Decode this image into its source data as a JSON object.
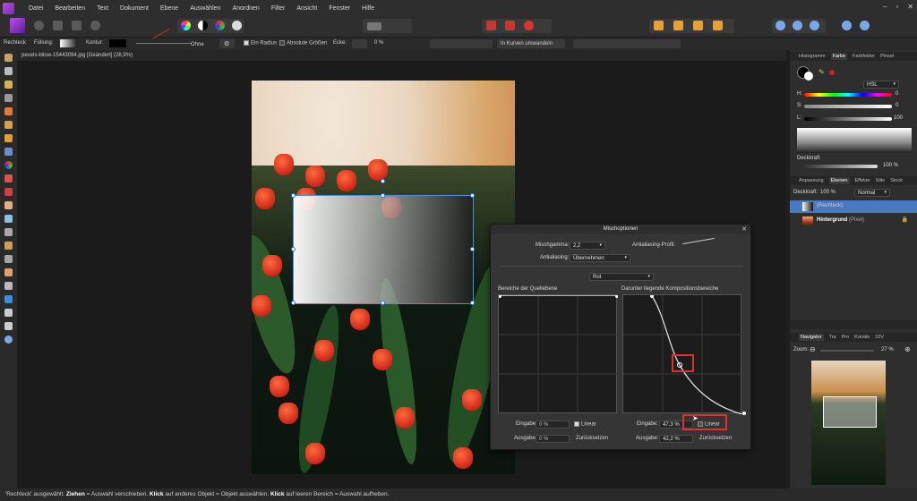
{
  "menu": {
    "items": [
      "Datei",
      "Bearbeiten",
      "Text",
      "Dokument",
      "Ebene",
      "Auswählen",
      "Anordnen",
      "Filter",
      "Ansicht",
      "Fenster",
      "Hilfe"
    ]
  },
  "context_bar": {
    "tool_name": "Rechteck",
    "fill_label": "Füllung:",
    "stroke_label": "Kontur:",
    "stroke_style": "Ohne",
    "radius_label": "Ein Radius",
    "absolute_sizes_label": "Absolute Größen",
    "corner_label": "Ecke:",
    "corner_value": "0 %",
    "convert_label": "In Kurven umwandeln"
  },
  "document": {
    "tab_title": "pexels-bilow-15443094.jpg [Geändert] (26,9%)"
  },
  "dialog": {
    "title": "Mischoptionen",
    "blend_gamma_label": "Mischgamma:",
    "blend_gamma_value": "2,2",
    "antialias_profile_label": "Antialiasing-Profil:",
    "antialias_label": "Antialiasing:",
    "antialias_value": "Übernehmen",
    "channel_value": "Rot",
    "source_range_label": "Bereiche der Quellebene",
    "underlying_range_label": "Darunter liegende Kompositionsbereiche",
    "left": {
      "input_label": "Eingabe:",
      "input_value": "0 %",
      "output_label": "Ausgabe:",
      "output_value": "0 %",
      "linear_label": "Linear",
      "reset_label": "Zurücksetzen"
    },
    "right": {
      "input_label": "Eingabe:",
      "input_value": "47,3 %",
      "output_label": "Ausgabe:",
      "output_value": "42,2 %",
      "linear_label": "Linear",
      "reset_label": "Zurücksetzen"
    }
  },
  "right_panel": {
    "tabs_top": [
      "Histogramm",
      "Farbe",
      "Farbfelder",
      "Pinsel"
    ],
    "color_model": "HSL",
    "h_label": "H:",
    "h_value": "0",
    "s_label": "S:",
    "s_value": "0",
    "l_label": "L:",
    "l_value": "100",
    "opacity_label": "Deckkraft",
    "opacity_value": "100 %",
    "tabs_mid": [
      "Anpassung",
      "Ebenen",
      "Effekte",
      "Stile",
      "Stock"
    ],
    "layer_opacity_label": "Deckkraft:",
    "layer_opacity_value": "100 %",
    "blend_mode": "Normal",
    "layers": [
      {
        "name": "(Rechteck)"
      },
      {
        "name": "Hintergrund",
        "type": "(Pixel)"
      }
    ],
    "tabs_bottom": [
      "Navigator",
      "Tra",
      "Pro",
      "Kanäle",
      "32V"
    ],
    "zoom_label": "Zoom:",
    "zoom_value": "27 %"
  },
  "status": {
    "part1": "'Rechteck' ausgewählt.",
    "b1": "Ziehen",
    "part2": "= Auswahl verschieben.",
    "b2": "Klick",
    "part3": "auf anderes Objekt = Objekt auswählen.",
    "b3": "Klick",
    "part4": "auf leeren Bereich = Auswahl aufheben."
  },
  "colors": {
    "accent": "#4a90e2",
    "highlight": "#e03030",
    "selected_layer": "#4a78c2"
  }
}
